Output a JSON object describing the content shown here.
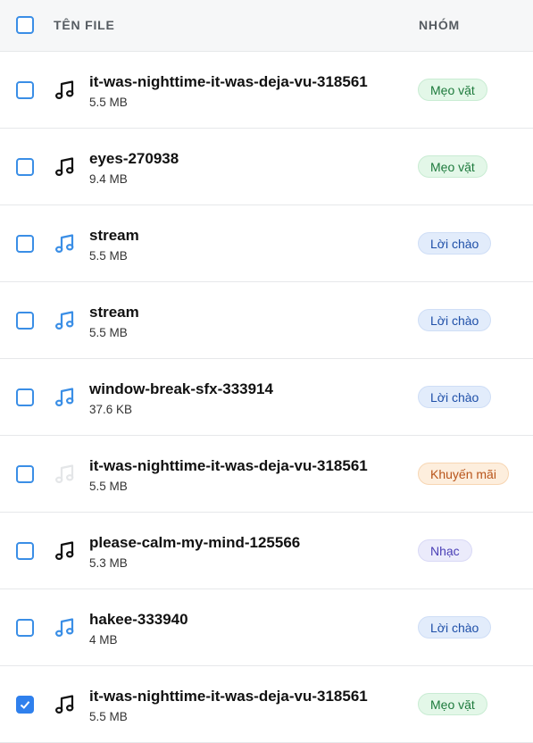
{
  "header": {
    "col_file": "TÊN FILE",
    "col_group": "NHÓM"
  },
  "colors": {
    "accent": "#2f80ed",
    "note_dark": "#111111",
    "note_blue": "#3a8ee6",
    "note_faint": "#e4e6e8"
  },
  "rows": [
    {
      "name": "it-was-nighttime-it-was-deja-vu-318561",
      "size": "5.5 MB",
      "group": "Mẹo vặt",
      "badge": "green",
      "icon": "music-note-icon",
      "icon_color": "#111111",
      "checked": false
    },
    {
      "name": "eyes-270938",
      "size": "9.4 MB",
      "group": "Mẹo vặt",
      "badge": "green",
      "icon": "music-note-icon",
      "icon_color": "#111111",
      "checked": false
    },
    {
      "name": "stream",
      "size": "5.5 MB",
      "group": "Lời chào",
      "badge": "blue",
      "icon": "music-note-icon",
      "icon_color": "#3a8ee6",
      "checked": false
    },
    {
      "name": "stream",
      "size": "5.5 MB",
      "group": "Lời chào",
      "badge": "blue",
      "icon": "music-note-icon",
      "icon_color": "#3a8ee6",
      "checked": false
    },
    {
      "name": "window-break-sfx-333914",
      "size": "37.6 KB",
      "group": "Lời chào",
      "badge": "blue",
      "icon": "music-note-icon",
      "icon_color": "#3a8ee6",
      "checked": false
    },
    {
      "name": "it-was-nighttime-it-was-deja-vu-318561",
      "size": "5.5 MB",
      "group": "Khuyến mãi",
      "badge": "orange",
      "icon": "music-note-icon",
      "icon_color": "#e4e6e8",
      "checked": false
    },
    {
      "name": "please-calm-my-mind-125566",
      "size": "5.3 MB",
      "group": "Nhạc",
      "badge": "purple",
      "icon": "music-note-icon",
      "icon_color": "#111111",
      "checked": false
    },
    {
      "name": "hakee-333940",
      "size": "4 MB",
      "group": "Lời chào",
      "badge": "blue",
      "icon": "music-note-icon",
      "icon_color": "#3a8ee6",
      "checked": false
    },
    {
      "name": "it-was-nighttime-it-was-deja-vu-318561",
      "size": "5.5 MB",
      "group": "Mẹo vặt",
      "badge": "green",
      "icon": "music-note-icon",
      "icon_color": "#111111",
      "checked": true
    }
  ]
}
